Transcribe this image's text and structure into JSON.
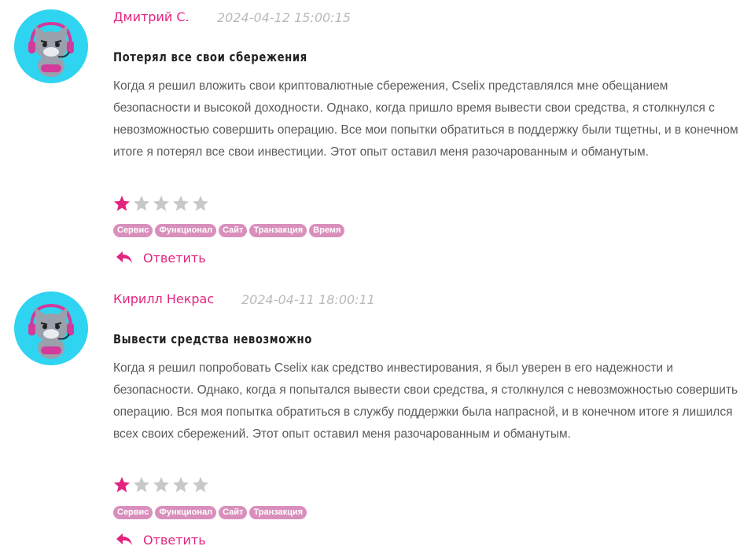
{
  "reviews": [
    {
      "author": "Дмитрий С.",
      "date": "2024-04-12 15:00:15",
      "title": "Потерял все свои сбережения",
      "body": "Когда я решил вложить свои криптовалютные сбережения, Cselix представлялся мне обещанием безопасности и высокой доходности. Однако, когда пришло время вывести свои средства, я столкнулся с невозможностью совершить операцию. Все мои попытки обратиться в поддержку были тщетны, и в конечном итоге я потерял все свои инвестиции. Этот опыт оставил меня разочарованным и обманутым.",
      "rating": 1,
      "rating_max": 5,
      "tags": [
        "Сервис",
        "Функционал",
        "Сайт",
        "Транзакция",
        "Время"
      ],
      "reply_label": "Ответить"
    },
    {
      "author": "Кирилл Некрас",
      "date": "2024-04-11 18:00:11",
      "title": "Вывести средства невозможно",
      "body": "Когда я решил попробовать Cselix как средство инвестирования, я был уверен в его надежности и безопасности. Однако, когда я попытался вывести свои средства, я столкнулся с невозможностью совершить операцию. Вся моя попытка обратиться в службу поддержки была напрасной, и в конечном итоге я лишился всех своих сбережений. Этот опыт оставил меня разочарованным и обманутым.",
      "rating": 1,
      "rating_max": 5,
      "tags": [
        "Сервис",
        "Функционал",
        "Сайт",
        "Транзакция"
      ],
      "reply_label": "Ответить"
    }
  ],
  "colors": {
    "accent": "#e3247f",
    "star_filled": "#e3247f",
    "star_empty": "#c8c8c8",
    "tag_bg": "#d98fbc",
    "avatar_bg": "#2fd4f0"
  },
  "icons": {
    "avatar": "cat-gamer-avatar-icon",
    "star": "star-icon",
    "reply": "reply-arrow-icon"
  }
}
